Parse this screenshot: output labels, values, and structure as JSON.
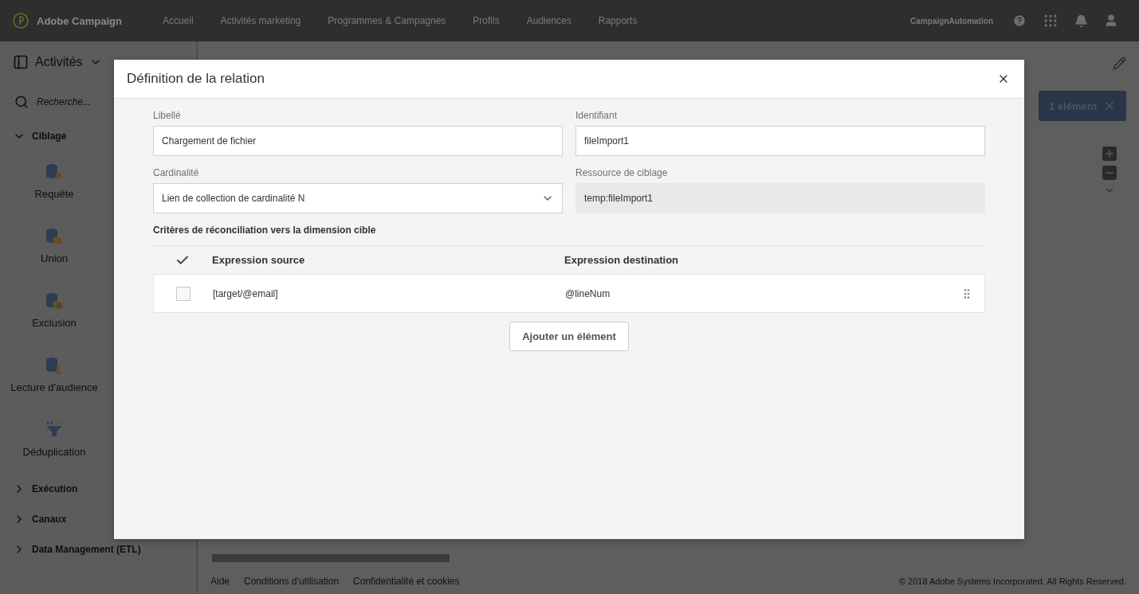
{
  "header": {
    "brand": "Adobe Campaign",
    "nav": [
      {
        "label": "Accueil",
        "selected": false
      },
      {
        "label": "Activités marketing",
        "selected": false
      },
      {
        "label": "Programmes & Campagnes",
        "selected": false
      },
      {
        "label": "Profils",
        "selected": false
      },
      {
        "label": "Audiences",
        "selected": false
      },
      {
        "label": "Rapports",
        "selected": false
      }
    ],
    "user": "CampaignAutomation"
  },
  "sidebar": {
    "title": "Activités",
    "search_placeholder": "Recherche...",
    "groups": [
      {
        "label": "Ciblage",
        "expanded": true,
        "items": [
          {
            "label": "Requête",
            "kind": "query"
          },
          {
            "label": "Union",
            "kind": "union"
          },
          {
            "label": "Exclusion",
            "kind": "exclusion"
          },
          {
            "label": "Lecture d'audience",
            "kind": "audience"
          },
          {
            "label": "Déduplication",
            "kind": "dedup"
          }
        ]
      },
      {
        "label": "Exécution",
        "expanded": false
      },
      {
        "label": "Canaux",
        "expanded": false
      },
      {
        "label": "Data Management (ETL)",
        "expanded": false
      }
    ]
  },
  "selection_button": "1 élément",
  "footer": {
    "links": [
      "Aide",
      "Conditions d'utilisation",
      "Confidentialité et cookies"
    ],
    "copyright": "© 2018 Adobe Systems Incorporated. All Rights Reserved."
  },
  "dialog": {
    "title": "Définition de la relation",
    "fields": [
      {
        "label": "Libellé",
        "value": "Chargement de fichier",
        "kind": "text"
      },
      {
        "label": "Identifiant",
        "value": "fileImport1",
        "kind": "text"
      },
      {
        "label": "Cardinalité",
        "value": "Lien de collection de cardinalité N",
        "kind": "select"
      },
      {
        "label": "Ressource de ciblage",
        "value": "temp:fileImport1",
        "kind": "readonly"
      }
    ],
    "section_title": "Critères de réconciliation vers la dimension cible",
    "columns": [
      "Expression source",
      "Expression destination"
    ],
    "rows": [
      {
        "checked": false,
        "source": "[target/@email]",
        "destination": "@lineNum"
      }
    ],
    "add_button": "Ajouter un élément"
  }
}
